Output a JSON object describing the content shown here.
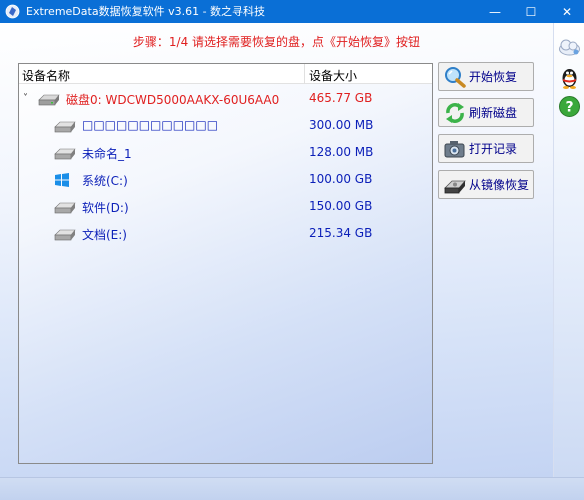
{
  "window": {
    "title": "ExtremeData数据恢复软件 v3.61  - 数之寻科技",
    "minimize": "—",
    "maximize": "☐",
    "close": "✕"
  },
  "step_instruction": "步骤：1/4 请选择需要恢复的盘，点《开始恢复》按钮",
  "device_list": {
    "headers": {
      "name": "设备名称",
      "size": "设备大小"
    },
    "disk": {
      "name": "磁盘0: WDCWD5000AAKX-60U6AA0",
      "size": "465.77 GB",
      "icon": "hard-disk-icon",
      "expanded": true
    },
    "partitions": [
      {
        "name": "□□□□□□□□□□□□",
        "size": "300.00 MB",
        "icon": "partition-drive-icon"
      },
      {
        "name": "未命名_1",
        "size": "128.00 MB",
        "icon": "partition-drive-icon"
      },
      {
        "name": "系统(C:)",
        "size": "100.00 GB",
        "icon": "windows-logo-icon"
      },
      {
        "name": "软件(D:)",
        "size": "150.00 GB",
        "icon": "partition-drive-icon"
      },
      {
        "name": "文档(E:)",
        "size": "215.34 GB",
        "icon": "partition-drive-icon"
      }
    ]
  },
  "actions": {
    "start_recovery": "开始恢复",
    "refresh_disk": "刷新磁盘",
    "open_record": "打开记录",
    "restore_from_image": "从镜像恢复"
  },
  "sidebar": {
    "items": [
      {
        "icon": "cloud-icon"
      },
      {
        "icon": "qq-penguin-icon"
      },
      {
        "icon": "help-icon"
      }
    ]
  },
  "colors": {
    "titlebar": "#0a6fd6",
    "instruction": "#e02020",
    "disk_text": "#e02020",
    "partition_text": "#0b1fb8",
    "button_text": "#00008b"
  }
}
